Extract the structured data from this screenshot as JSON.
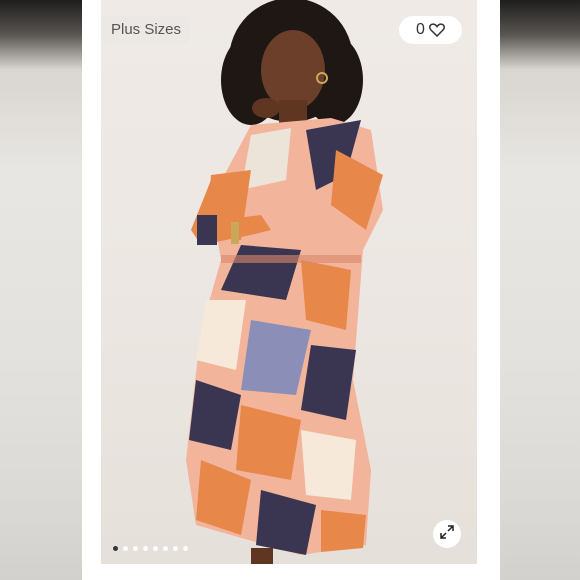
{
  "listing": {
    "badge_label": "Plus Sizes",
    "like_count": "0",
    "carousel": {
      "total_images": 8,
      "active_index": 0
    }
  },
  "icons": {
    "like": "heart-icon",
    "expand": "expand-icon"
  },
  "colors": {
    "accent_orange": "#e8874a",
    "navy": "#3a3550",
    "peach": "#f2b49a"
  }
}
